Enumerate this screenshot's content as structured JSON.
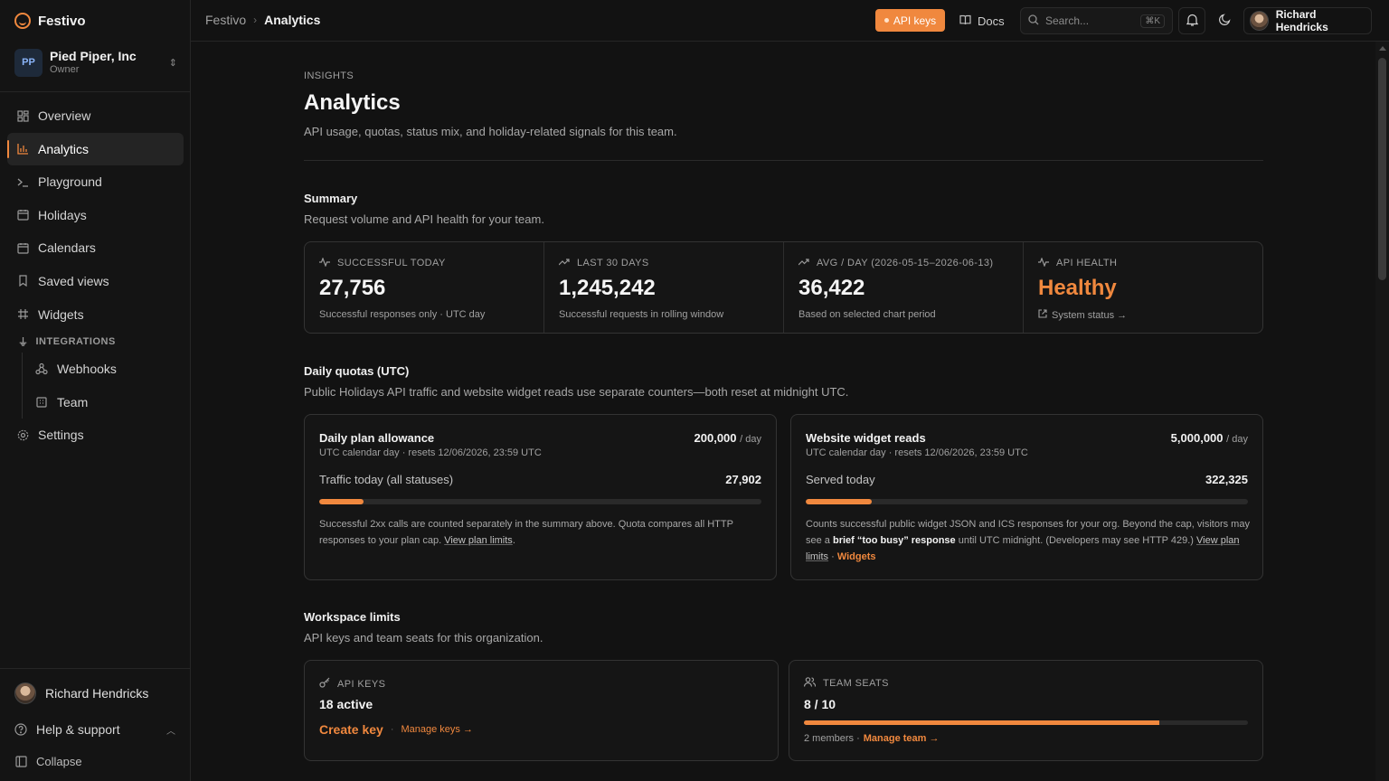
{
  "app": {
    "name": "Festivo"
  },
  "org": {
    "initials": "PP",
    "name": "Pied Piper, Inc",
    "role": "Owner"
  },
  "sidebar": {
    "items": [
      {
        "label": "Overview"
      },
      {
        "label": "Analytics"
      },
      {
        "label": "Playground"
      },
      {
        "label": "Holidays"
      },
      {
        "label": "Calendars"
      },
      {
        "label": "Saved views"
      },
      {
        "label": "Widgets"
      }
    ],
    "integrations_label": "INTEGRATIONS",
    "integrations": [
      {
        "label": "Webhooks"
      },
      {
        "label": "Team"
      }
    ],
    "settings_label": "Settings",
    "user_name": "Richard Hendricks",
    "help_label": "Help & support",
    "collapse_label": "Collapse"
  },
  "header": {
    "breadcrumb_root": "Festivo",
    "breadcrumb_current": "Analytics",
    "api_keys_label": "API keys",
    "docs_label": "Docs",
    "search_placeholder": "Search...",
    "search_shortcut": "⌘K",
    "user_name": "Richard Hendricks"
  },
  "page": {
    "eyebrow": "INSIGHTS",
    "title": "Analytics",
    "subtitle": "API usage, quotas, status mix, and holiday-related signals for this team."
  },
  "summary": {
    "title": "Summary",
    "subtitle": "Request volume and API health for your team.",
    "stats": [
      {
        "label": "SUCCESSFUL TODAY",
        "value": "27,756",
        "foot": "Successful responses only · UTC day"
      },
      {
        "label": "LAST 30 DAYS",
        "value": "1,245,242",
        "foot": "Successful requests in rolling window"
      },
      {
        "label": "AVG / DAY (2026-05-15–2026-06-13)",
        "value": "36,422",
        "foot": "Based on selected chart period"
      },
      {
        "label": "API HEALTH",
        "value": "Healthy",
        "foot": "System status →"
      }
    ]
  },
  "quotas": {
    "title": "Daily quotas (UTC)",
    "subtitle": "Public Holidays API traffic and website widget reads use separate counters—both reset at midnight UTC.",
    "plan": {
      "title": "Daily plan allowance",
      "limit": "200,000",
      "unit": "/ day",
      "reset": "UTC calendar day · resets 12/06/2026, 23:59 UTC",
      "row_label": "Traffic today (all statuses)",
      "row_value": "27,902",
      "progress": 0.1,
      "note_a": "Successful 2xx calls are counted separately in the summary above. Quota compares all HTTP responses to your plan cap. ",
      "note_link": "View plan limits",
      "note_b": "."
    },
    "widget": {
      "title": "Website widget reads",
      "limit": "5,000,000",
      "unit": "/ day",
      "reset": "UTC calendar day · resets 12/06/2026, 23:59 UTC",
      "row_label": "Served today",
      "row_value": "322,325",
      "progress": 0.15,
      "note_a": "Counts successful public widget JSON and ICS responses for your org. Beyond the cap, visitors may see a ",
      "note_bold": "brief “too busy” response",
      "note_b": " until UTC midnight. (Developers may see HTTP 429.) ",
      "note_link": "View plan limits",
      "note_sep": " · ",
      "note_widgets": "Widgets"
    }
  },
  "limits": {
    "title": "Workspace limits",
    "subtitle": "API keys and team seats for this organization.",
    "api_keys": {
      "label": "API KEYS",
      "value": "18 active",
      "create": "Create key",
      "sep": "·",
      "manage": "Manage keys →"
    },
    "seats": {
      "label": "TEAM SEATS",
      "value": "8 / 10",
      "progress": 0.8,
      "foot": "2 members ·",
      "manage": "Manage team →"
    }
  },
  "colors": {
    "accent": "#f0883e",
    "background": "#121212"
  }
}
